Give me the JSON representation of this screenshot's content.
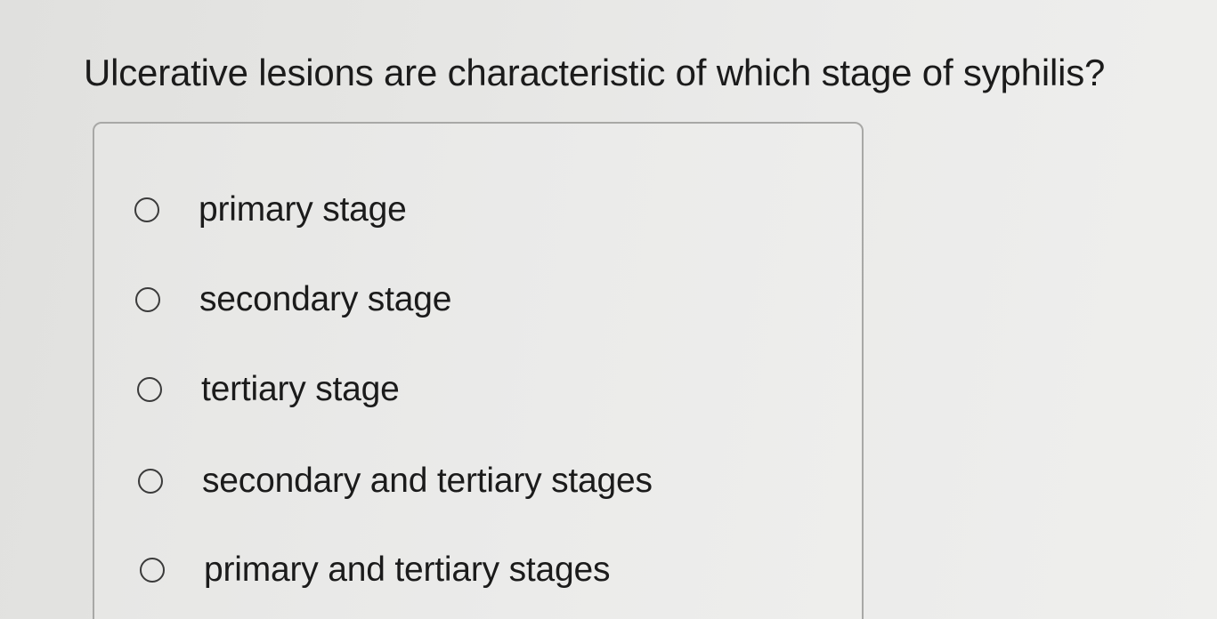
{
  "question": {
    "text": "Ulcerative lesions are characteristic of which stage of syphilis?"
  },
  "options": [
    {
      "label": "primary stage",
      "selected": false
    },
    {
      "label": "secondary stage",
      "selected": false
    },
    {
      "label": "tertiary stage",
      "selected": false
    },
    {
      "label": "secondary and tertiary stages",
      "selected": false
    },
    {
      "label": "primary and tertiary stages",
      "selected": false
    }
  ]
}
